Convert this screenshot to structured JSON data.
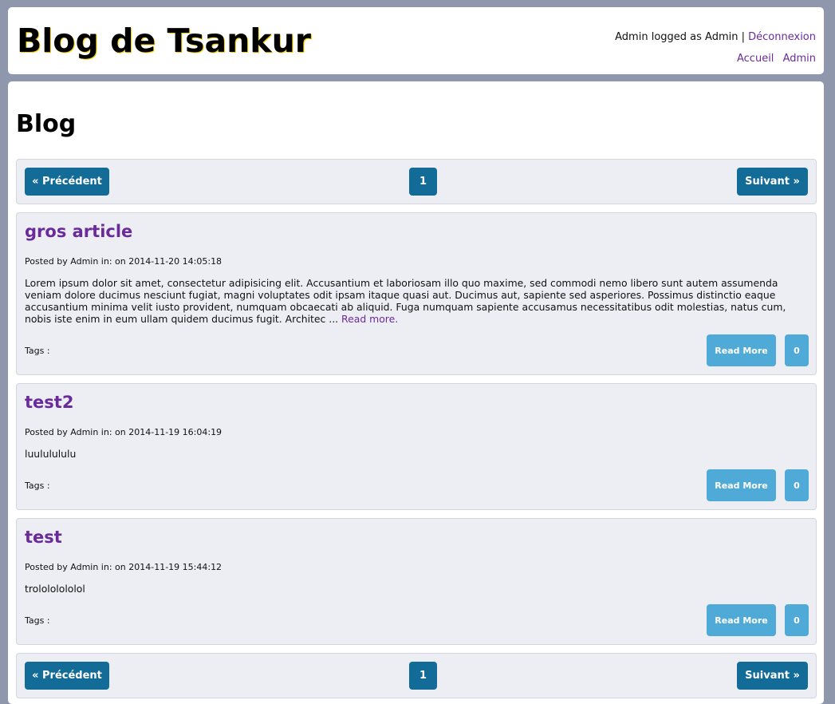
{
  "header": {
    "site_title": "Blog de Tsankur",
    "user_text": "Admin logged as Admin",
    "separator": "|",
    "logout_label": "Déconnexion",
    "nav": [
      "Accueil",
      "Admin"
    ]
  },
  "main": {
    "page_title": "Blog"
  },
  "pagination": {
    "prev_label": "« Précédent",
    "current_page": "1",
    "next_label": "Suivant »"
  },
  "posts": [
    {
      "title": "gros article",
      "meta": "Posted by Admin in: on 2014-11-20 14:05:18",
      "body": "Lorem ipsum dolor sit amet, consectetur adipisicing elit. Accusantium et laboriosam illo quo maxime, sed commodi nemo libero sunt autem assumenda veniam dolore ducimus nesciunt fugiat, magni voluptates odit ipsam itaque quasi aut. Ducimus aut, sapiente sed asperiores. Possimus distinctio eaque accusantium minima velit iusto provident, numquam obcaecati ab aliquid. Fuga numquam sapiente accusamus necessitatibus odit molestias, natus cum, nobis iste enim in eum ullam quidem ducimus fugit. Architec ... ",
      "read_more_link": "Read more.",
      "tags": "Tags :",
      "read_more_button": "Read More",
      "comment_count": "0"
    },
    {
      "title": "test2",
      "meta": "Posted by Admin in: on 2014-11-19 16:04:19",
      "body": "luululululu",
      "tags": "Tags :",
      "read_more_button": "Read More",
      "comment_count": "0"
    },
    {
      "title": "test",
      "meta": "Posted by Admin in: on 2014-11-19 15:44:12",
      "body": "trolololololol",
      "tags": "Tags :",
      "read_more_button": "Read More",
      "comment_count": "0"
    }
  ]
}
